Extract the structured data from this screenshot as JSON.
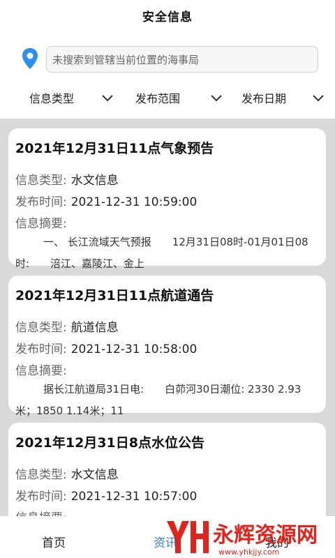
{
  "header": {
    "title": "安全信息"
  },
  "search": {
    "placeholder": "未搜索到管辖当前位置的海事局"
  },
  "filters": [
    {
      "label": "信息类型"
    },
    {
      "label": "发布范围"
    },
    {
      "label": "发布日期"
    }
  ],
  "labels": {
    "type": "信息类型:",
    "time": "发布时间:",
    "summary": "信息摘要:"
  },
  "cards": [
    {
      "title": "2021年12月31日11点气象预告",
      "type": "水文信息",
      "time": "2021-12-31 10:59:00",
      "summary": "一、 长江流域天气预报　　12月31日08时-01月01日08时:　　涪江、嘉陵江、金上"
    },
    {
      "title": "2021年12月31日11点航道通告",
      "type": "航道信息",
      "time": "2021-12-31 10:58:00",
      "summary": "据长江航道局31日电:　　白茆河30日潮位: 2330 2.93米；1850 1.14米；11"
    },
    {
      "title": "2021年12月31日8点水位公告",
      "type": "水文信息",
      "time": "2021-12-31 10:57:00",
      "summary": ""
    }
  ],
  "nav": {
    "home": "首页",
    "info": "资讯",
    "mine": "我的"
  },
  "watermark": {
    "text": "永辉资源网",
    "url": "www.yhkjjy.com"
  },
  "colors": {
    "accent": "#2e7ae6",
    "watermark_red": "#e0241b",
    "feed_bg": "#d9d9d9"
  }
}
